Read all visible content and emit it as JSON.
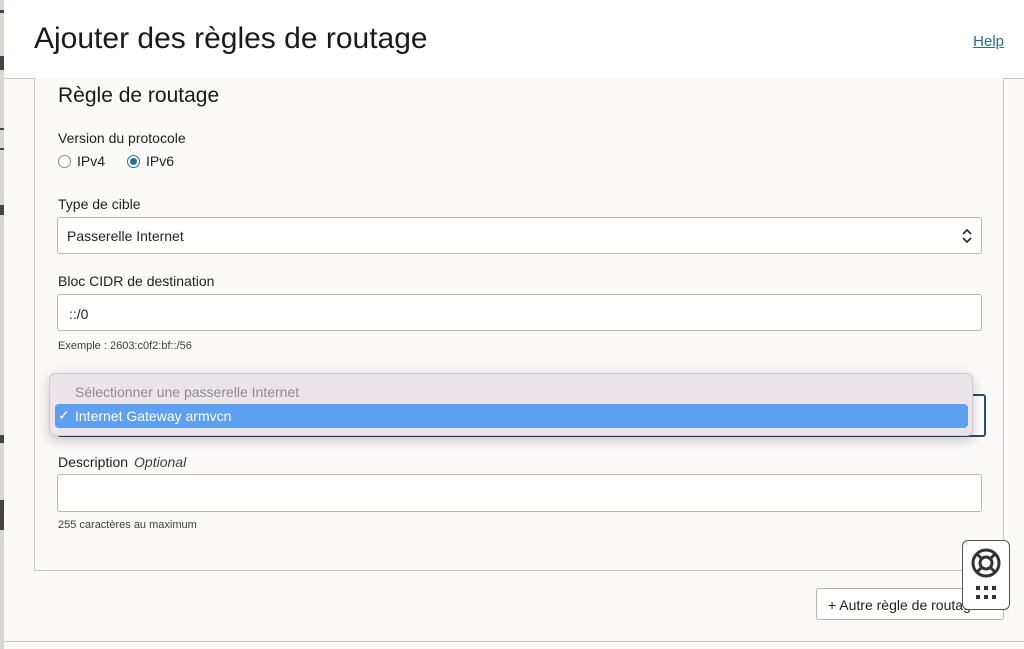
{
  "header": {
    "title": "Ajouter des règles de routage",
    "help_label": "Help"
  },
  "rule": {
    "title": "Règle de routage",
    "protocol": {
      "label": "Version du protocole",
      "options": [
        "IPv4",
        "IPv6"
      ],
      "selected": "IPv6"
    },
    "target_type": {
      "label": "Type de cible",
      "value": "Passerelle Internet"
    },
    "destination": {
      "label": "Bloc CIDR de destination",
      "value": "::/0",
      "hint": "Exemple : 2603:c0f2:bf::/56"
    },
    "gateway_dropdown": {
      "placeholder": "Sélectionner une passerelle Internet",
      "selected_option": "Internet Gateway armvcn",
      "check": "✓"
    },
    "description": {
      "label": "Description",
      "optional": "Optional",
      "value": "",
      "hint": "255 caractères au maximum"
    }
  },
  "footer": {
    "add_rule_label": "+ Autre règle de routage"
  },
  "colors": {
    "link": "#2b6a94",
    "highlight": "#5f9ff0",
    "focus_border": "#2b4f66"
  }
}
